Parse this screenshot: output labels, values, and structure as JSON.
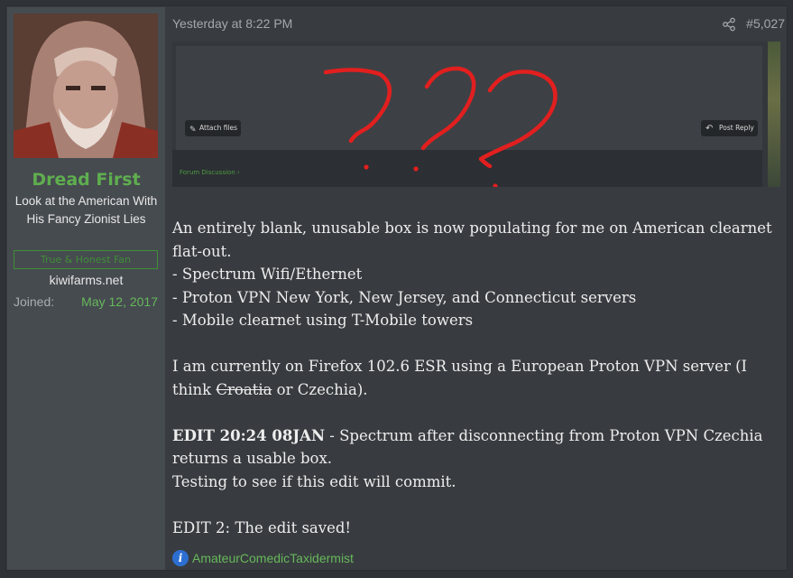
{
  "user": {
    "avatar_icon": "user-avatar-icon",
    "name": "Dread First",
    "title": "Look at the American With His Fancy Zionist Lies",
    "banner": "True & Honest Fan",
    "site": "kiwifarms.net",
    "joined_label": "Joined:",
    "joined_date": "May 12, 2017",
    "name_color": "#5fae4f"
  },
  "post": {
    "date": "Yesterday at 8:22 PM",
    "share_icon": "share-icon",
    "number": "#5,027"
  },
  "screenshot": {
    "attach_label": "Attach files",
    "reply_label": "Post Reply",
    "forum_label": "Forum Discussion",
    "annotation_color": "#e21f1f",
    "annotation": "???"
  },
  "body": {
    "p1": "An entirely blank, unusable box is now populating for me on American clearnet flat-out.",
    "l1": "- Spectrum Wifi/Ethernet",
    "l2": "- Proton VPN New York, New Jersey, and Connecticut servers",
    "l3": "- Mobile clearnet using T-Mobile towers",
    "p2_a": "I am currently on Firefox 102.6 ESR using a European Proton VPN server (I think ",
    "p2_strike": "Croatia",
    "p2_b": " or Czechia).",
    "edit_bold": "EDIT 20:24 08JAN",
    "edit_rest": " - Spectrum after disconnecting from Proton VPN Czechia returns a usable box.",
    "edit_line2": "Testing to see if this edit will commit.",
    "edit2": "EDIT 2: The edit saved!"
  },
  "signature": {
    "icon": "info-icon",
    "text": "AmateurComedicTaxidermist"
  }
}
